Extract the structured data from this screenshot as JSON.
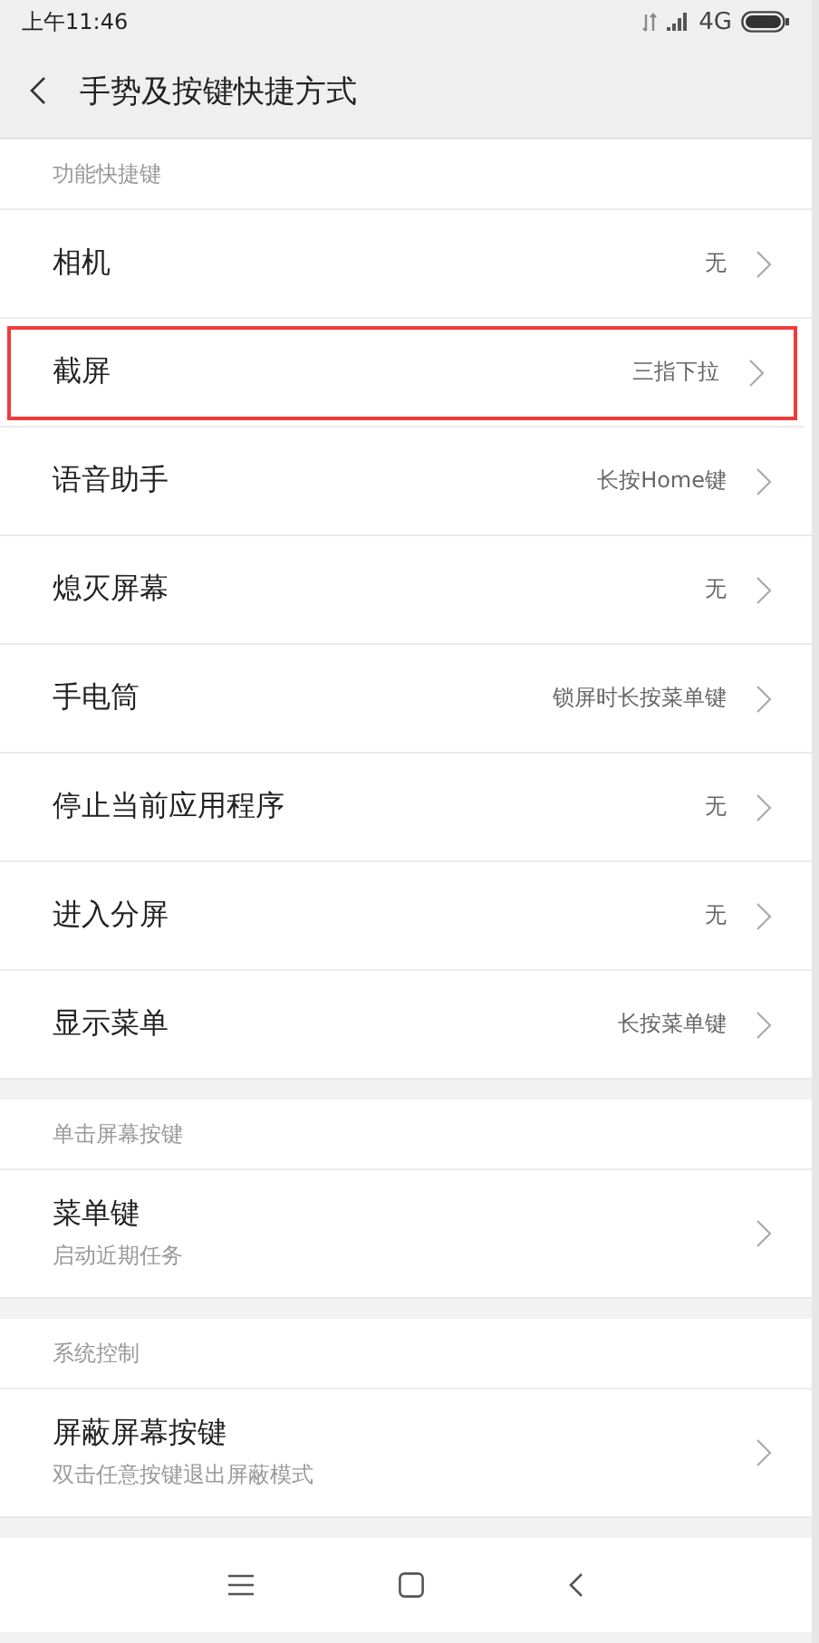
{
  "status_bar": {
    "time": "上午11:46",
    "network": "4G"
  },
  "title_bar": {
    "title": "手势及按键快捷方式"
  },
  "sections": [
    {
      "header": "功能快捷键",
      "items": [
        {
          "label": "相机",
          "value": "无",
          "highlighted": false
        },
        {
          "label": "截屏",
          "value": "三指下拉",
          "highlighted": true
        },
        {
          "label": "语音助手",
          "value": "长按Home键",
          "highlighted": false
        },
        {
          "label": "熄灭屏幕",
          "value": "无",
          "highlighted": false
        },
        {
          "label": "手电筒",
          "value": "锁屏时长按菜单键",
          "highlighted": false
        },
        {
          "label": "停止当前应用程序",
          "value": "无",
          "highlighted": false
        },
        {
          "label": "进入分屏",
          "value": "无",
          "highlighted": false
        },
        {
          "label": "显示菜单",
          "value": "长按菜单键",
          "highlighted": false
        }
      ]
    },
    {
      "header": "单击屏幕按键",
      "items": [
        {
          "label": "菜单键",
          "subtitle": "启动近期任务",
          "highlighted": false
        }
      ]
    },
    {
      "header": "系统控制",
      "items": [
        {
          "label": "屏蔽屏幕按键",
          "subtitle": "双击任意按键退出屏蔽模式",
          "highlighted": false
        }
      ]
    }
  ]
}
